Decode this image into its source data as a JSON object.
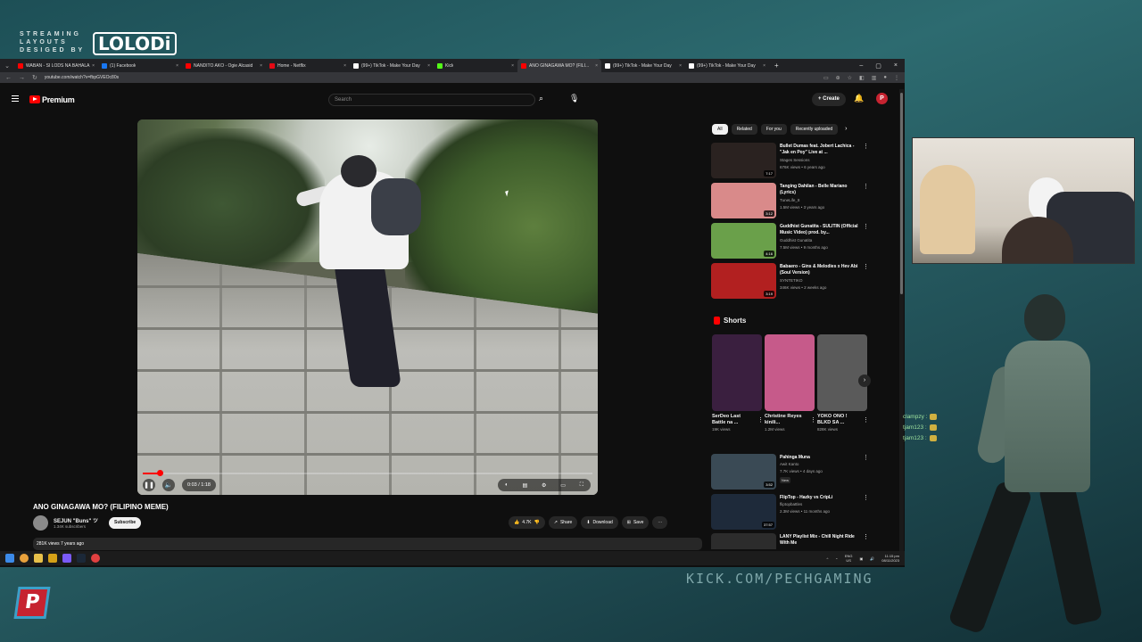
{
  "overlay": {
    "brand_line1": "STREAMING",
    "brand_line2": "LAYOUTS",
    "brand_line3": "DESIGED BY",
    "brand_logo": "LOLODi",
    "kick_url": "KICK.COM/PECHGAMING"
  },
  "browser": {
    "tabs": [
      {
        "label": "WABAN - SI LODS NA BAHALA",
        "color": "#ff0000",
        "active": false
      },
      {
        "label": "(1) Facebook",
        "color": "#1877f2",
        "active": false
      },
      {
        "label": "NANDITO AKO - Ogie Alcasid",
        "color": "#ff0000",
        "active": false
      },
      {
        "label": "Home - Netflix",
        "color": "#e50914",
        "active": false
      },
      {
        "label": "(99+) TikTok - Make Your Day",
        "color": "#ffffff",
        "active": false
      },
      {
        "label": "Kick",
        "color": "#53fc18",
        "active": false
      },
      {
        "label": "ANO GINAGAWA MO? (FILI...",
        "color": "#ff0000",
        "active": true
      },
      {
        "label": "(99+) TikTok - Make Your Day",
        "color": "#ffffff",
        "active": false
      },
      {
        "label": "(99+) TikTok - Make Your Day",
        "color": "#ffffff",
        "active": false
      }
    ],
    "url": "youtube.com/watch?v=fbpGVEOc80s"
  },
  "youtube": {
    "logo_text": "Premium",
    "search_placeholder": "Search",
    "create_label": "+ Create",
    "profile_initial": "P"
  },
  "player": {
    "time": "0:03 / 1:18",
    "progress_fraction": 0.038
  },
  "video": {
    "title": "ANO GINAGAWA MO? (FILIPINO MEME)",
    "channel": "SEJUN \"Buns\" ツ",
    "subscribers": "1.34K subscribers",
    "subscribe_label": "Subscribe",
    "likes": "4.7K",
    "share_label": "Share",
    "download_label": "Download",
    "save_label": "Save",
    "views_date": "281K views  7 years ago"
  },
  "sidebar": {
    "chips": [
      "All",
      "Related",
      "For you",
      "Recently uploaded"
    ],
    "recommendations": [
      {
        "title": "Bullet Dumas feat. Jobert Lachica - \"Jak en Poy\" Live at ...",
        "channel": "Stages Sessions",
        "meta": "676K views • 6 years ago",
        "duration": "7:17",
        "thumb": "#2a2220",
        "badge": ""
      },
      {
        "title": "Tanging Dahilan - Belle Mariano (Lyrics)",
        "channel": "TuneLife_8",
        "meta": "1.5M views • 3 years ago",
        "duration": "3:12",
        "thumb": "#d98a8a",
        "badge": ""
      },
      {
        "title": "Guddhist Gunatita - SULITIN (Official Music Video) prod. by...",
        "channel": "Guddhist Gunatita",
        "meta": "7.5M views • 9 months ago",
        "duration": "4:16",
        "thumb": "#6aa04a",
        "badge": ""
      },
      {
        "title": "Babaero - Gins & Melodies x Hev Abi (Soul Version)",
        "channel": "SYNTETIKO",
        "meta": "346K views • 2 weeks ago",
        "duration": "3:19",
        "thumb": "#b22020",
        "badge": ""
      },
      {
        "title": "Pahinga Muna",
        "channel": "Awit Kanto",
        "meta": "7.7K views • 4 days ago",
        "duration": "3:52",
        "thumb": "#3a4a55",
        "badge": "New"
      },
      {
        "title": "FlipTop - Hazky vs CripLi",
        "channel": "fliptopbattles",
        "meta": "2.3M views • 11 months ago",
        "duration": "37:57",
        "thumb": "#1e2a3a",
        "badge": ""
      },
      {
        "title": "LANY Playlist Mix - Chill Night Ride With Me",
        "channel": "",
        "meta": "",
        "duration": "",
        "thumb": "#2c2c2c",
        "badge": ""
      }
    ],
    "shorts_heading": "Shorts",
    "shorts": [
      {
        "title": "SerDeo Last Battle na ...",
        "views": "19K views",
        "thumb": "#3a1f3f"
      },
      {
        "title": "Christine Reyes kinili...",
        "views": "1.2M views",
        "thumb": "#c65a8a"
      },
      {
        "title": "YOKO ONO ! BLKD SA ...",
        "views": "828K views",
        "thumb": "#5a5a5a"
      }
    ]
  },
  "taskbar": {
    "lang": "ENG",
    "region": "US",
    "time": "11:15 pm",
    "date": "08/11/2023"
  },
  "chat": [
    {
      "user": "clampzy :"
    },
    {
      "user": "tjam123 :"
    },
    {
      "user": "tjam123 :"
    }
  ]
}
